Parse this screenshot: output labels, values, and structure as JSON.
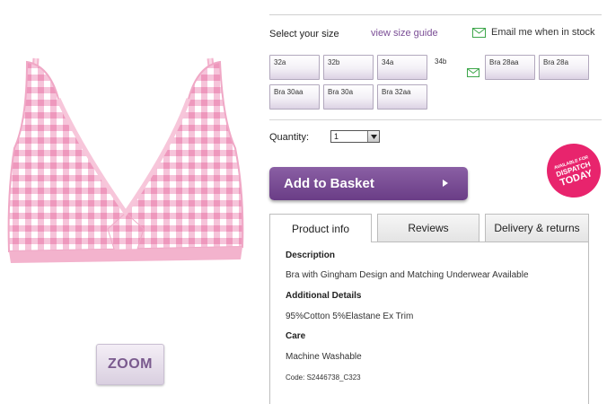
{
  "size_section": {
    "label": "Select your size",
    "guide_link": "view size guide",
    "email_link": "Email me when in stock",
    "sizes": [
      {
        "label": "32a"
      },
      {
        "label": "32b"
      },
      {
        "label": "34a"
      },
      {
        "label": "34b",
        "out_of_stock": true
      },
      {
        "label": "Bra 28aa"
      },
      {
        "label": "Bra 28a"
      },
      {
        "label": "Bra 30aa"
      },
      {
        "label": "Bra 30a"
      },
      {
        "label": "Bra 32aa"
      }
    ]
  },
  "quantity": {
    "label": "Quantity:",
    "value": "1"
  },
  "basket_button": {
    "label": "Add to Basket"
  },
  "zoom_button": {
    "label": "ZOOM"
  },
  "badge": {
    "lines": [
      "AVAILABLE FOR",
      "DISPATCH",
      "TODAY"
    ]
  },
  "tabs": [
    {
      "label": "Product info",
      "active": true
    },
    {
      "label": "Reviews",
      "active": false
    },
    {
      "label": "Delivery & returns",
      "active": false
    }
  ],
  "product_info": {
    "description_heading": "Description",
    "description": "Bra with Gingham Design and Matching Underwear Available",
    "details_heading": "Additional Details",
    "details": "95%Cotton 5%Elastane Ex Trim",
    "care_heading": "Care",
    "care": "Machine Washable",
    "code": "Code: S2446738_C323"
  },
  "colors": {
    "accent": "#7b4e96",
    "button": "#6a3d86",
    "badge": "#e8246d",
    "gingham": "#f2a6c6"
  }
}
